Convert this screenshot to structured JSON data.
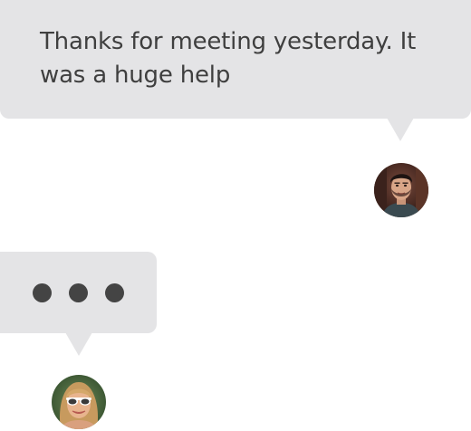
{
  "conversation": {
    "outgoing_message": {
      "text": "Thanks for meeting yesterday. It was a huge help"
    },
    "typing_indicator": {
      "dot_count": 3
    }
  },
  "avatars": {
    "sender": {
      "icon": "man-avatar-photo"
    },
    "recipient": {
      "icon": "woman-avatar-photo"
    }
  },
  "colors": {
    "bubble": "#e4e4e6",
    "text": "#3f3f3f",
    "dot": "#444444",
    "background": "#ffffff"
  }
}
